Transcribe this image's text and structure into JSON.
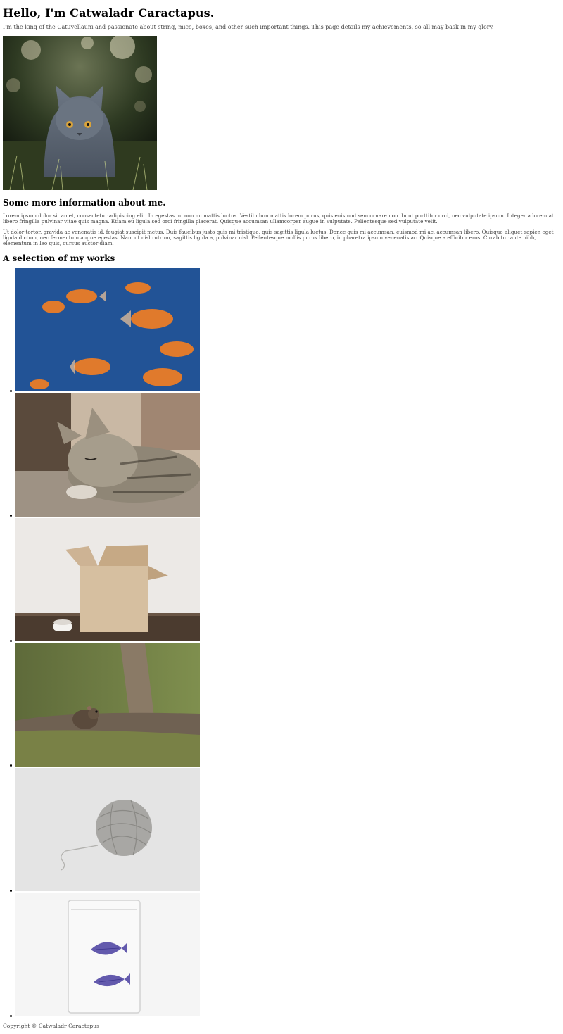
{
  "header": {
    "title": "Hello, I'm Catwaladr Caractapus.",
    "intro": "I'm the king of the Catuvellauni and passionate about string, mice, boxes, and other such important things. This page details my achievements, so all may bask in my glory."
  },
  "hero_image": {
    "icon": "gray-cat-photo"
  },
  "about": {
    "heading": "Some more information about me.",
    "paragraphs": [
      "Lorem ipsum dolor sit amet, consectetur adipiscing elit. In egestas mi non mi mattis luctus. Vestibulum mattis lorem purus, quis euismod sem ornare non. In ut porttitor orci, nec vulputate ipsum. Integer a lorem at libero fringilla pulvinar vitae quis magna. Etiam eu ligula sed orci fringilla placerat. Quisque accumsan ullamcorper augue in vulputate. Pellentesque sed vulputate velit.",
      "Ut dolor tortor, gravida ac venenatis id, feugiat suscipit metus. Duis faucibus justo quis mi tristique, quis sagittis ligula luctus. Donec quis mi accumsan, euismod mi ac, accumsan libero. Quisque aliquet sapien eget ligula dictum, nec fermentum augue egestas. Nam ut nisl rutrum, sagittis ligula a, pulvinar nisl. Pellentesque mollis purus libero, in pharetra ipsum venenatis ac. Quisque a efficitur eros. Curabitur ante nibh, elementum in leo quis, cursus auctor diam."
    ]
  },
  "works": {
    "heading": "A selection of my works",
    "items": [
      {
        "icon": "goldfish-photo"
      },
      {
        "icon": "sleeping-kitten-photo"
      },
      {
        "icon": "cardboard-box-photo"
      },
      {
        "icon": "mouse-photo"
      },
      {
        "icon": "yarn-ball-photo"
      },
      {
        "icon": "xray-fish-jar-photo"
      }
    ]
  },
  "footer": {
    "copyright": "Copyright © Catwaladr Caractapus"
  },
  "colors": {
    "text": "#000000",
    "muted": "#444444",
    "background": "#ffffff"
  }
}
